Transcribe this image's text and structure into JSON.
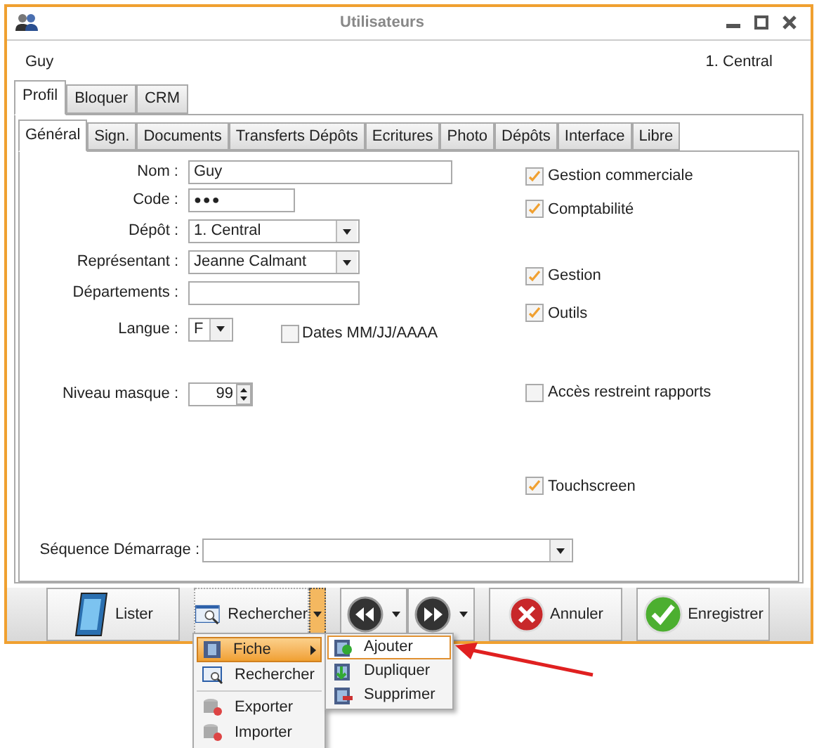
{
  "window": {
    "title": "Utilisateurs"
  },
  "header": {
    "user": "Guy",
    "depot": "1. Central"
  },
  "outer_tabs": [
    {
      "label": "Profil",
      "selected": true
    },
    {
      "label": "Bloquer",
      "selected": false
    },
    {
      "label": "CRM",
      "selected": false
    }
  ],
  "inner_tabs": [
    {
      "label": "Général",
      "selected": true
    },
    {
      "label": "Sign.",
      "selected": false
    },
    {
      "label": "Documents",
      "selected": false
    },
    {
      "label": "Transferts Dépôts",
      "selected": false
    },
    {
      "label": "Ecritures",
      "selected": false
    },
    {
      "label": "Photo",
      "selected": false
    },
    {
      "label": "Dépôts",
      "selected": false
    },
    {
      "label": "Interface",
      "selected": false
    },
    {
      "label": "Libre",
      "selected": false
    }
  ],
  "fields": [
    {
      "label": "Nom :",
      "kind": "text",
      "value": "Guy"
    },
    {
      "label": "Code :",
      "kind": "password",
      "value": "●●●"
    },
    {
      "label": "Dépôt :",
      "kind": "combo",
      "value": "1. Central"
    },
    {
      "label": "Représentant :",
      "kind": "combo",
      "value": "Jeanne Calmant"
    },
    {
      "label": "Départements :",
      "kind": "text"
    },
    {
      "label": "Langue :",
      "kind": "small_combo",
      "value": "F",
      "checkbox": {
        "label": "Dates MM/JJ/AAAA",
        "checked": false
      }
    },
    {
      "label": "Niveau masque :",
      "kind": "spinner",
      "value": "99"
    }
  ],
  "options": [
    {
      "label": "Gestion commerciale",
      "checked": true
    },
    {
      "label": "Comptabilité",
      "checked": true
    },
    {
      "label": "Gestion",
      "checked": true
    },
    {
      "label": "Outils",
      "checked": true
    },
    {
      "label": "Accès restreint rapports",
      "checked": false
    },
    {
      "label": "Touchscreen",
      "checked": true
    }
  ],
  "sequence": {
    "label": "Séquence Démarrage :"
  },
  "buttons": [
    {
      "label": "Lister",
      "kind": "list"
    },
    {
      "label": "Rechercher",
      "kind": "search"
    },
    {
      "kind": "nav"
    },
    {
      "label": "Annuler",
      "kind": "cancel"
    },
    {
      "label": "Enregistrer",
      "kind": "save"
    }
  ],
  "menu": {
    "items": [
      {
        "kind": "item",
        "label": "Fiche",
        "selected": true,
        "submenu": true
      },
      {
        "kind": "item",
        "label": "Rechercher",
        "selected": false,
        "submenu": false
      },
      {
        "kind": "separator"
      },
      {
        "kind": "item",
        "label": "Exporter",
        "selected": false,
        "submenu": false
      },
      {
        "kind": "item",
        "label": "Importer",
        "selected": false,
        "submenu": false
      }
    ],
    "submenu": [
      {
        "label": "Ajouter",
        "selected": true
      },
      {
        "label": "Dupliquer",
        "selected": false
      },
      {
        "label": "Supprimer",
        "selected": false
      }
    ]
  }
}
